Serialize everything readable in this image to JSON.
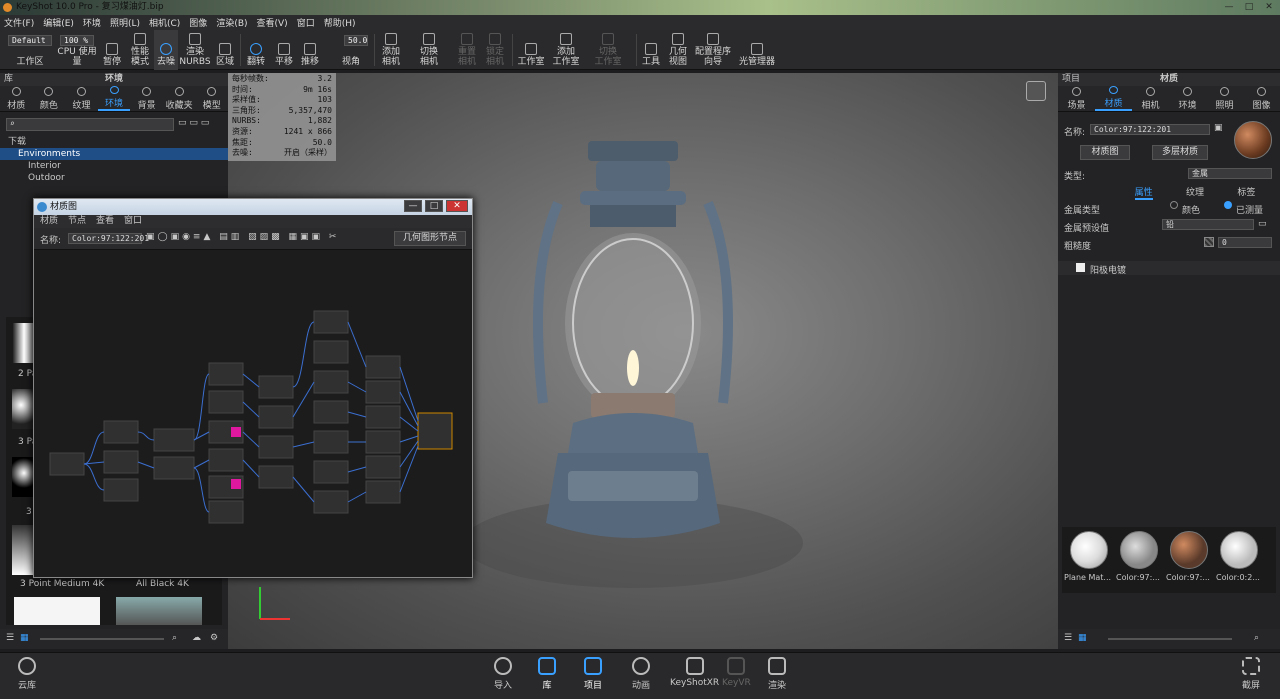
{
  "window": {
    "title": "KeyShot 10.0 Pro - 复习煤油灯.bip",
    "min": "—",
    "max": "□",
    "close": "✕"
  },
  "menu": [
    "文件(F)",
    "编辑(E)",
    "环境",
    "照明(L)",
    "相机(C)",
    "图像",
    "渲染(B)",
    "查看(V)",
    "窗口",
    "帮助(H)"
  ],
  "toolbar": {
    "workspace_value": "Default",
    "workspace_label": "工作区",
    "cpu_value": "100 %",
    "cpu_label": "CPU 使用量",
    "pause": "暂停",
    "perf": "性能\n模式",
    "denoise": "去噪",
    "render_nurbs": "渲染\nNURBS",
    "region": "区域",
    "flip": "翻转",
    "pan": "平移",
    "push": "推移",
    "fov_value": "50.0",
    "fov_label": "视角",
    "add_camera": "添加\n相机",
    "switch_camera": "切换\n相机",
    "reset_camera": "重置\n相机",
    "lock_camera": "锁定\n相机",
    "studio": "工作室",
    "add_studio": "添加\n工作室",
    "switch_studio": "切换\n工作室",
    "tools": "工具",
    "geom_view": "几何\n视图",
    "config": "配置程序\n向导",
    "light_mgr": "光管理器"
  },
  "library": {
    "title": "库",
    "header": "环境",
    "tabs": [
      "材质",
      "颜色",
      "纹理",
      "环境",
      "背景",
      "收藏夹",
      "模型"
    ],
    "tree": [
      "下载",
      "Environments",
      "Interior",
      "Outdoor"
    ],
    "thumbs": [
      "2 Pa",
      "3 Pa",
      "3",
      "3 Point Medium 4K",
      "All Black 4K"
    ]
  },
  "stats": [
    [
      "每秒帧数:",
      "3.2"
    ],
    [
      "时间:",
      "9m 16s"
    ],
    [
      "采样值:",
      "103"
    ],
    [
      "三角形:",
      "5,357,470"
    ],
    [
      "NURBS:",
      "1,882"
    ],
    [
      "资源:",
      "1241 x 866"
    ],
    [
      "焦距:",
      "50.0"
    ],
    [
      "去噪:",
      "开启（采样）"
    ]
  ],
  "matgraph": {
    "title": "材质图",
    "menu": [
      "材质",
      "节点",
      "查看",
      "窗口"
    ],
    "name_label": "名称:",
    "name_value": "Color:97:122:201",
    "geom_node": "几何图形节点"
  },
  "project": {
    "title": "项目",
    "header": "材质",
    "tabs": [
      "场景",
      "材质",
      "相机",
      "环境",
      "照明",
      "图像"
    ],
    "name_label": "名称:",
    "name_value": "Color:97:122:201",
    "matgraph_btn": "材质图",
    "multilayer_btn": "多层材质",
    "type_label": "类型:",
    "type_value": "金属",
    "subtabs": [
      "属性",
      "纹理",
      "标签"
    ],
    "metal_type": "金属类型",
    "opt_color": "颜色",
    "opt_measured": "已测量",
    "preset_label": "金属预设值",
    "preset_value": "铅",
    "rough_label": "粗糙度",
    "rough_value": "0",
    "anodize": "阳极电镀",
    "mats": [
      "Plane Mat...",
      "Color:97:...",
      "Color:97:...",
      "Color:0:2..."
    ]
  },
  "bottom": {
    "cloud": "云库",
    "import": "导入",
    "library": "库",
    "project": "项目",
    "animation": "动画",
    "keyshotxr": "KeyShotXR",
    "keyvr": "KeyVR",
    "render": "渲染",
    "screenshot": "截屏"
  }
}
